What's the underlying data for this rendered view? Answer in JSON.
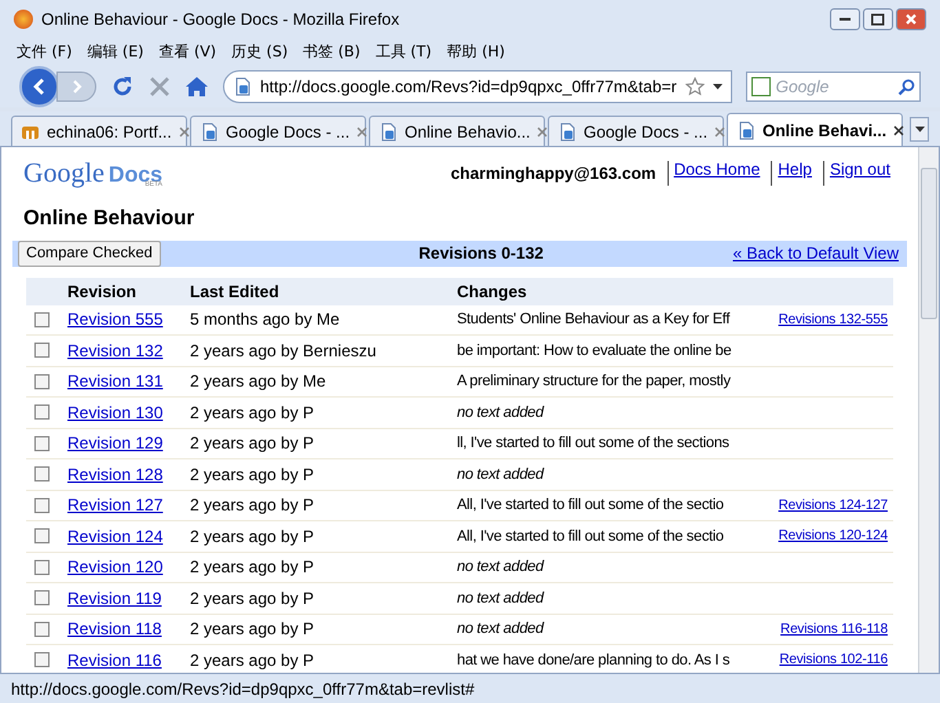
{
  "window": {
    "title": "Online Behaviour - Google Docs - Mozilla Firefox"
  },
  "menu": [
    "文件 (F)",
    "编辑 (E)",
    "查看 (V)",
    "历史 (S)",
    "书签 (B)",
    "工具 (T)",
    "帮助 (H)"
  ],
  "address": {
    "value": "http://docs.google.com/Revs?id=dp9qpxc_0ffr77m&tab=r"
  },
  "search": {
    "placeholder": "Google"
  },
  "tabs": [
    {
      "label": "echina06: Portf...",
      "kind": "site",
      "selected": false
    },
    {
      "label": "Google Docs - ...",
      "kind": "doc",
      "selected": false
    },
    {
      "label": "Online Behavio...",
      "kind": "doc",
      "selected": false
    },
    {
      "label": "Google Docs - ...",
      "kind": "doc",
      "selected": false
    },
    {
      "label": "Online Behavi...",
      "kind": "doc",
      "selected": true
    }
  ],
  "logo": {
    "word": "Google",
    "product": "Docs",
    "badge": "BETA"
  },
  "account": {
    "email": "charminghappy@163.com",
    "links": [
      "Docs Home",
      "Help",
      "Sign out"
    ]
  },
  "doc_title": "Online Behaviour",
  "toolbar": {
    "button": "Compare Checked",
    "range": "Revisions 0-132",
    "back_link": "« Back to Default View"
  },
  "table": {
    "columns": [
      "Revision",
      "Last Edited",
      "Changes"
    ],
    "rows": [
      {
        "checked": false,
        "revision": "Revision 555",
        "edited": "5 months ago by Me",
        "changes": "Students' Online Behaviour as a Key for Eff",
        "empty": false,
        "range": "Revisions 132-555"
      },
      {
        "checked": false,
        "revision": "Revision 132",
        "edited": "2 years ago by Bernieszu",
        "changes": "be important: How to evaluate the online be",
        "empty": false
      },
      {
        "checked": false,
        "revision": "Revision 131",
        "edited": "2 years ago by Me",
        "changes": "A preliminary structure for the paper, mostly",
        "empty": false
      },
      {
        "checked": false,
        "revision": "Revision 130",
        "edited": "2 years ago by P",
        "changes": "no text added",
        "empty": true
      },
      {
        "checked": false,
        "revision": "Revision 129",
        "edited": "2 years ago by P",
        "changes": "ll, I've started to fill out some of the sections",
        "empty": false
      },
      {
        "checked": false,
        "revision": "Revision 128",
        "edited": "2 years ago by P",
        "changes": "no text added",
        "empty": true
      },
      {
        "checked": false,
        "revision": "Revision 127",
        "edited": "2 years ago by P",
        "changes": "All, I've started to fill out some of the sectio",
        "empty": false,
        "range": "Revisions 124-127"
      },
      {
        "checked": false,
        "revision": "Revision 124",
        "edited": "2 years ago by P",
        "changes": "All, I've started to fill out some of the sectio",
        "empty": false,
        "range": "Revisions 120-124"
      },
      {
        "checked": false,
        "revision": "Revision 120",
        "edited": "2 years ago by P",
        "changes": "no text added",
        "empty": true
      },
      {
        "checked": false,
        "revision": "Revision 119",
        "edited": "2 years ago by P",
        "changes": "no text added",
        "empty": true
      },
      {
        "checked": false,
        "revision": "Revision 118",
        "edited": "2 years ago by P",
        "changes": "no text added",
        "empty": true,
        "range": "Revisions 116-118"
      },
      {
        "checked": false,
        "revision": "Revision 116",
        "edited": "2 years ago by P",
        "changes": "hat we have done/are planning to do. As I s",
        "empty": false,
        "range": "Revisions 102-116"
      }
    ]
  },
  "status_bar": "http://docs.google.com/Revs?id=dp9qpxc_0ffr77m&tab=revlist#"
}
